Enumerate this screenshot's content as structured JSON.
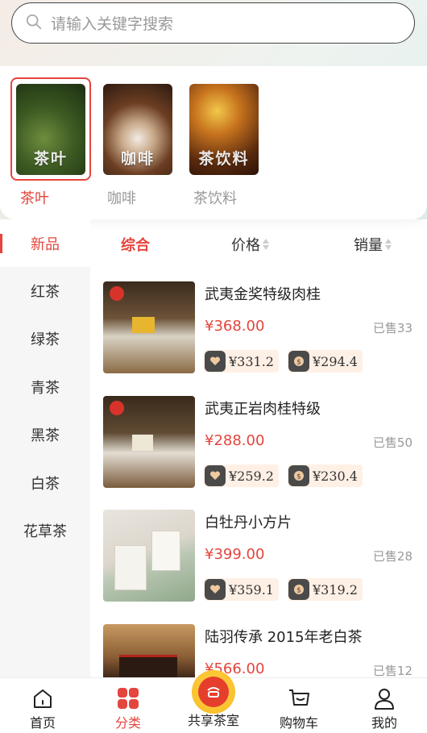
{
  "search": {
    "placeholder": "请输入关键字搜索"
  },
  "categories": [
    {
      "label": "茶叶",
      "thumb_text": "茶叶",
      "active": true
    },
    {
      "label": "咖啡",
      "thumb_text": "咖啡",
      "active": false
    },
    {
      "label": "茶饮料",
      "thumb_text": "茶饮料",
      "active": false
    }
  ],
  "sidebar": {
    "items": [
      "新品",
      "红茶",
      "绿茶",
      "青茶",
      "黑茶",
      "白茶",
      "花草茶"
    ],
    "active": "新品"
  },
  "sort": {
    "overall": "综合",
    "price": "价格",
    "sales": "销量"
  },
  "products": [
    {
      "name": "武夷金奖特级肉桂",
      "price": "¥368.00",
      "sold": "已售33",
      "vip1": "¥331.2",
      "vip2": "¥294.4"
    },
    {
      "name": "武夷正岩肉桂特级",
      "price": "¥288.00",
      "sold": "已售50",
      "vip1": "¥259.2",
      "vip2": "¥230.4"
    },
    {
      "name": "白牡丹小方片",
      "price": "¥399.00",
      "sold": "已售28",
      "vip1": "¥359.1",
      "vip2": "¥319.2"
    },
    {
      "name": "陆羽传承 2015年老白茶",
      "price": "¥566.00",
      "sold": "已售12"
    }
  ],
  "tabbar": {
    "home": "首页",
    "category": "分类",
    "shared_tearoom": "共享茶室",
    "cart": "购物车",
    "mine": "我的"
  },
  "colors": {
    "accent": "#e4453d",
    "sidebar_bg": "#f6f6f6",
    "vip_bg": "#fff0e6"
  },
  "icons": [
    "search-icon",
    "home-icon",
    "category-grid-icon",
    "tearoom-logo-icon",
    "cart-icon",
    "user-icon",
    "vip-heart-icon",
    "vip-coin-icon"
  ]
}
